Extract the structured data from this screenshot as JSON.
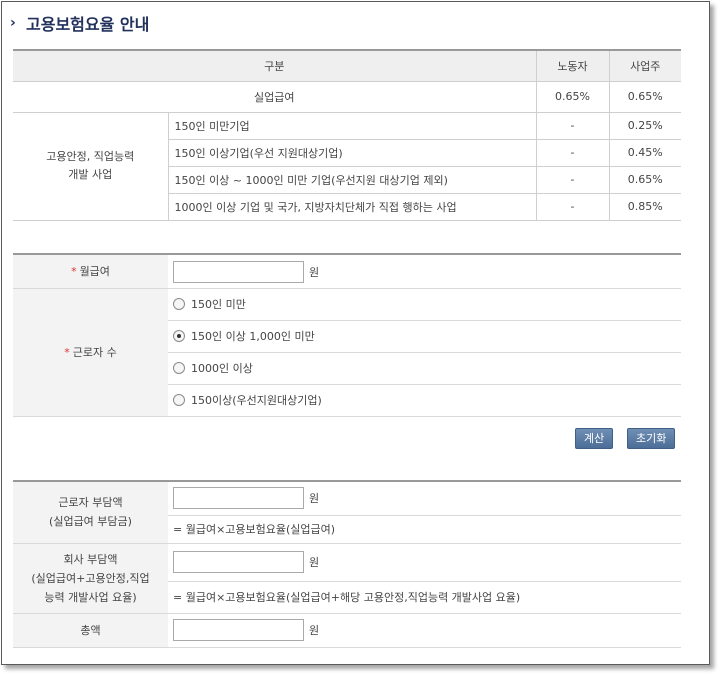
{
  "title": "고용보험요율 안내",
  "rate_table": {
    "headers": {
      "category": "구분",
      "worker": "노동자",
      "employer": "사업주"
    },
    "unemployment": {
      "label": "실업급여",
      "worker": "0.65%",
      "employer": "0.65%"
    },
    "group_label_line1": "고용안정, 직업능력",
    "group_label_line2": "개발 사업",
    "rows": [
      {
        "label": "150인 미만기업",
        "worker": "-",
        "employer": "0.25%"
      },
      {
        "label": "150인 이상기업(우선 지원대상기업)",
        "worker": "-",
        "employer": "0.45%"
      },
      {
        "label": "150인 이상 ~ 1000인 미만 기업(우선지원 대상기업 제외)",
        "worker": "-",
        "employer": "0.65%"
      },
      {
        "label": "1000인 이상 기업 및 국가, 지방자치단체가 직접 행하는 사업",
        "worker": "-",
        "employer": "0.85%"
      }
    ]
  },
  "form": {
    "required_mark": "*",
    "salary_label": "월급여",
    "salary_value": "",
    "unit": "원",
    "workers_label": "근로자 수",
    "options": [
      {
        "label": "150인 미만"
      },
      {
        "label": "150인 이상 1,000인 미만"
      },
      {
        "label": "1000인 이상"
      },
      {
        "label": "150이상(우선지원대상기업)"
      }
    ],
    "selected": "150인 이상 1,000인 미만"
  },
  "buttons": {
    "calculate": "계산",
    "reset": "초기화"
  },
  "results": {
    "worker_label_line1": "근로자 부담액",
    "worker_label_line2": "(실업급여 부담금)",
    "worker_formula": "= 월급여×고용보험요율(실업급여)",
    "company_label_line1": "회사 부담액",
    "company_label_line2": "(실업급여+고용안정,직업",
    "company_label_line3": "능력 개발사업 요율)",
    "company_formula": "= 월급여×고용보험요율(실업급여+해당 고용안정,직업능력 개발사업 요율)",
    "total_label": "총액",
    "unit": "원"
  }
}
